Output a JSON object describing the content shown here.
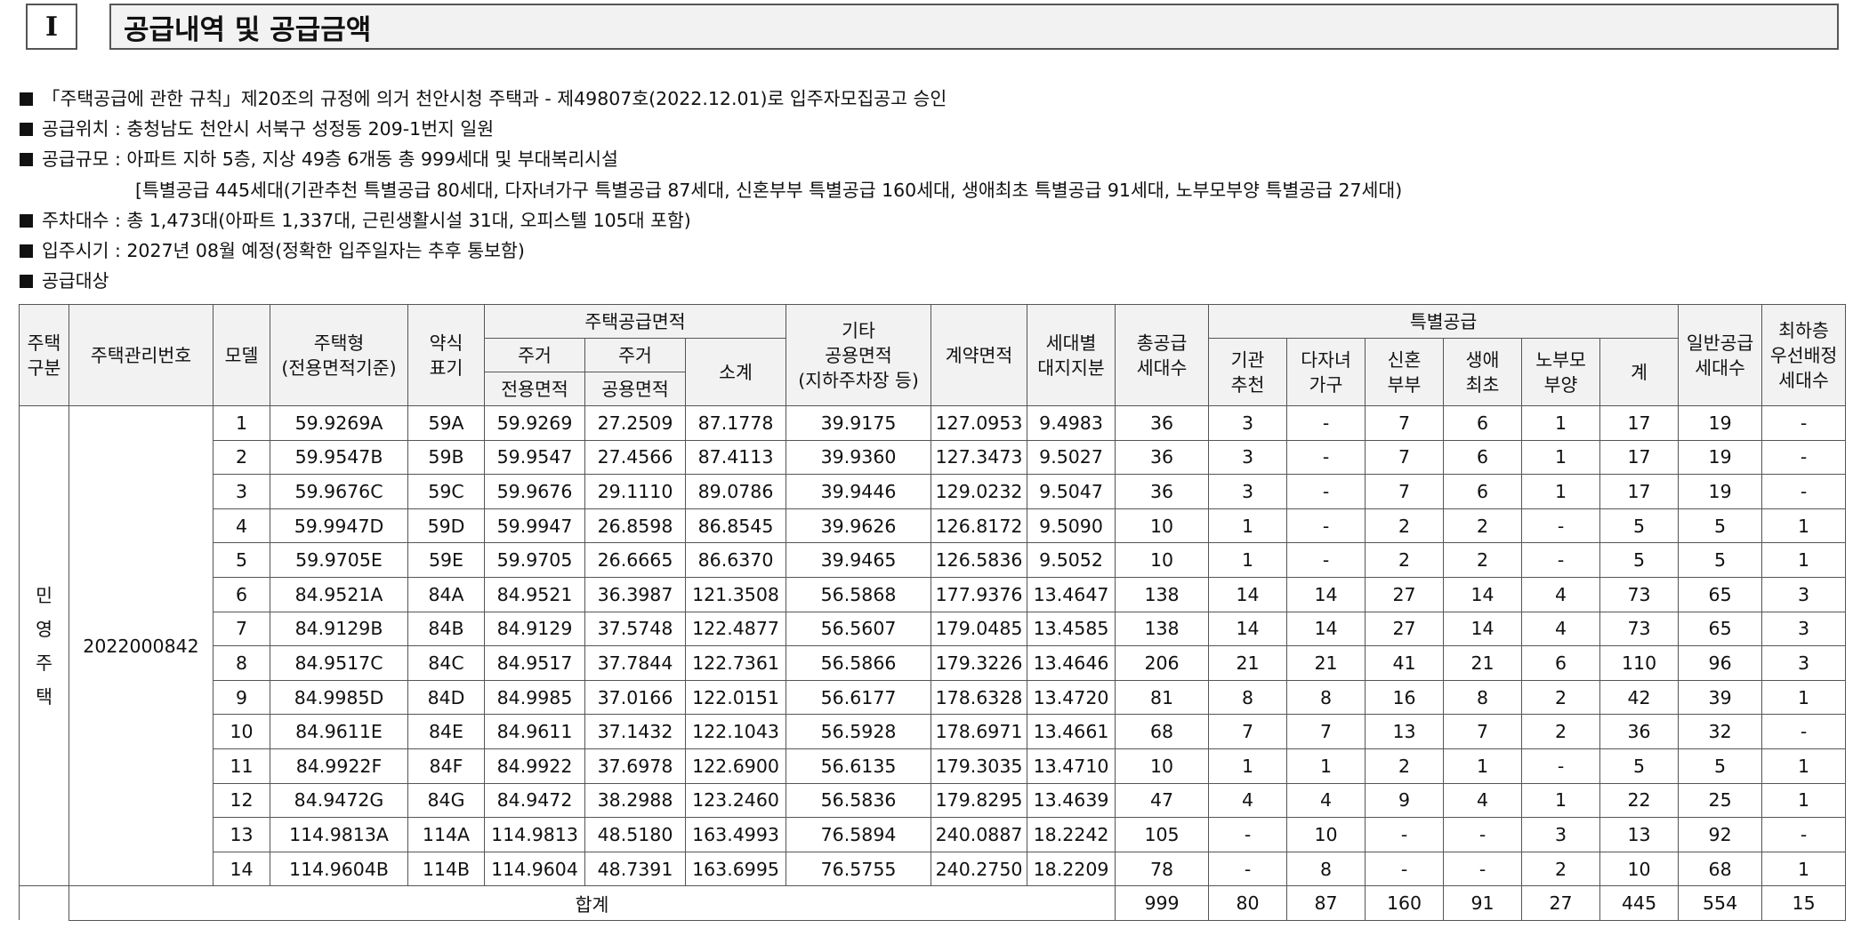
{
  "header": {
    "number": "I",
    "title": "공급내역 및 공급금액"
  },
  "bullets": [
    {
      "text": "「주택공급에 관한 규칙」제20조의 규정에 의거 천안시청 주택과 - 제49807호(2022.12.01)로 입주자모집공고 승인"
    },
    {
      "text": "공급위치 : 충청남도 천안시 서북구 성정동 209-1번지 일원"
    },
    {
      "text": "공급규모 : 아파트 지하 5층, 지상 49층 6개동 총 999세대 및 부대복리시설"
    },
    {
      "text": "[특별공급 445세대(기관추천 특별공급 80세대, 다자녀가구 특별공급 87세대, 신혼부부 특별공급 160세대, 생애최초 특별공급 91세대, 노부모부양 특별공급 27세대)"
    },
    {
      "text": "주차대수 : 총 1,473대(아파트 1,337대, 근린생활시설 31대, 오피스텔 105대 포함)"
    },
    {
      "text": "입주시기 : 2027년 08월 예정(정확한 입주일자는 추후 통보함)"
    },
    {
      "text": "공급대상"
    }
  ],
  "table": {
    "headers": {
      "housing_type_1": "주택",
      "housing_type_2": "구분",
      "mgmt_no": "주택관리번호",
      "model": "모델",
      "house_type_1": "주택형",
      "house_type_2": "(전용면적기준)",
      "abbr_1": "약식",
      "abbr_2": "표기",
      "supply_area": "주택공급면적",
      "res_1": "주거",
      "res_exclusive": "전용면적",
      "res_2": "주거",
      "res_common": "공용면적",
      "subtotal": "소계",
      "other_1": "기타",
      "other_2": "공용면적",
      "other_3": "(지하주차장 등)",
      "contract_area": "계약면적",
      "land_1": "세대별",
      "land_2": "대지지분",
      "total_supply_1": "총공급",
      "total_supply_2": "세대수",
      "special": "특별공급",
      "sp_inst_1": "기관",
      "sp_inst_2": "추천",
      "sp_multi_1": "다자녀",
      "sp_multi_2": "가구",
      "sp_newly_1": "신혼",
      "sp_newly_2": "부부",
      "sp_first_1": "생애",
      "sp_first_2": "최초",
      "sp_elder_1": "노부모",
      "sp_elder_2": "부양",
      "sp_sum": "계",
      "general_1": "일반공급",
      "general_2": "세대수",
      "lowest_1": "최하층",
      "lowest_2": "우선배정",
      "lowest_3": "세대수"
    },
    "category_chars": [
      "민",
      "영",
      "주",
      "택"
    ],
    "mgmt_no": "2022000842",
    "rows": [
      [
        "1",
        "59.9269A",
        "59A",
        "59.9269",
        "27.2509",
        "87.1778",
        "39.9175",
        "127.0953",
        "9.4983",
        "36",
        "3",
        "-",
        "7",
        "6",
        "1",
        "17",
        "19",
        "-"
      ],
      [
        "2",
        "59.9547B",
        "59B",
        "59.9547",
        "27.4566",
        "87.4113",
        "39.9360",
        "127.3473",
        "9.5027",
        "36",
        "3",
        "-",
        "7",
        "6",
        "1",
        "17",
        "19",
        "-"
      ],
      [
        "3",
        "59.9676C",
        "59C",
        "59.9676",
        "29.1110",
        "89.0786",
        "39.9446",
        "129.0232",
        "9.5047",
        "36",
        "3",
        "-",
        "7",
        "6",
        "1",
        "17",
        "19",
        "-"
      ],
      [
        "4",
        "59.9947D",
        "59D",
        "59.9947",
        "26.8598",
        "86.8545",
        "39.9626",
        "126.8172",
        "9.5090",
        "10",
        "1",
        "-",
        "2",
        "2",
        "-",
        "5",
        "5",
        "1"
      ],
      [
        "5",
        "59.9705E",
        "59E",
        "59.9705",
        "26.6665",
        "86.6370",
        "39.9465",
        "126.5836",
        "9.5052",
        "10",
        "1",
        "-",
        "2",
        "2",
        "-",
        "5",
        "5",
        "1"
      ],
      [
        "6",
        "84.9521A",
        "84A",
        "84.9521",
        "36.3987",
        "121.3508",
        "56.5868",
        "177.9376",
        "13.4647",
        "138",
        "14",
        "14",
        "27",
        "14",
        "4",
        "73",
        "65",
        "3"
      ],
      [
        "7",
        "84.9129B",
        "84B",
        "84.9129",
        "37.5748",
        "122.4877",
        "56.5607",
        "179.0485",
        "13.4585",
        "138",
        "14",
        "14",
        "27",
        "14",
        "4",
        "73",
        "65",
        "3"
      ],
      [
        "8",
        "84.9517C",
        "84C",
        "84.9517",
        "37.7844",
        "122.7361",
        "56.5866",
        "179.3226",
        "13.4646",
        "206",
        "21",
        "21",
        "41",
        "21",
        "6",
        "110",
        "96",
        "3"
      ],
      [
        "9",
        "84.9985D",
        "84D",
        "84.9985",
        "37.0166",
        "122.0151",
        "56.6177",
        "178.6328",
        "13.4720",
        "81",
        "8",
        "8",
        "16",
        "8",
        "2",
        "42",
        "39",
        "1"
      ],
      [
        "10",
        "84.9611E",
        "84E",
        "84.9611",
        "37.1432",
        "122.1043",
        "56.5928",
        "178.6971",
        "13.4661",
        "68",
        "7",
        "7",
        "13",
        "7",
        "2",
        "36",
        "32",
        "-"
      ],
      [
        "11",
        "84.9922F",
        "84F",
        "84.9922",
        "37.6978",
        "122.6900",
        "56.6135",
        "179.3035",
        "13.4710",
        "10",
        "1",
        "1",
        "2",
        "1",
        "-",
        "5",
        "5",
        "1"
      ],
      [
        "12",
        "84.9472G",
        "84G",
        "84.9472",
        "38.2988",
        "123.2460",
        "56.5836",
        "179.8295",
        "13.4639",
        "47",
        "4",
        "4",
        "9",
        "4",
        "1",
        "22",
        "25",
        "1"
      ],
      [
        "13",
        "114.9813A",
        "114A",
        "114.9813",
        "48.5180",
        "163.4993",
        "76.5894",
        "240.0887",
        "18.2242",
        "105",
        "-",
        "10",
        "-",
        "-",
        "3",
        "13",
        "92",
        "-"
      ],
      [
        "14",
        "114.9604B",
        "114B",
        "114.9604",
        "48.7391",
        "163.6995",
        "76.5755",
        "240.2750",
        "18.2209",
        "78",
        "-",
        "8",
        "-",
        "-",
        "2",
        "10",
        "68",
        "1"
      ]
    ],
    "total": {
      "label": "합계",
      "values": [
        "999",
        "80",
        "87",
        "160",
        "91",
        "27",
        "445",
        "554",
        "15"
      ]
    }
  }
}
